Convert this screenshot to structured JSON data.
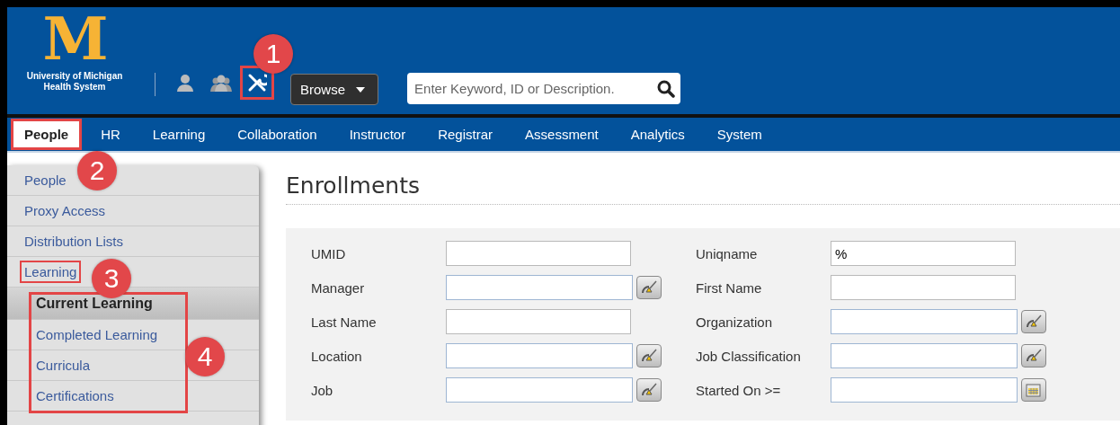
{
  "header": {
    "logo": {
      "letter": "M",
      "line1": "University of Michigan",
      "line2": "Health System"
    },
    "tools": [
      {
        "kind": "person",
        "annotated": false
      },
      {
        "kind": "group",
        "annotated": false
      },
      {
        "kind": "tools",
        "annotated": true
      }
    ],
    "browse": {
      "label": "Browse"
    },
    "search": {
      "placeholder": "Enter Keyword, ID or Description."
    }
  },
  "nav": [
    {
      "label": "People",
      "selected": true,
      "annotated": true
    },
    {
      "label": "HR",
      "selected": false,
      "annotated": false
    },
    {
      "label": "Learning",
      "selected": false,
      "annotated": false
    },
    {
      "label": "Collaboration",
      "selected": false,
      "annotated": false
    },
    {
      "label": "Instructor",
      "selected": false,
      "annotated": false
    },
    {
      "label": "Registrar",
      "selected": false,
      "annotated": false
    },
    {
      "label": "Assessment",
      "selected": false,
      "annotated": false
    },
    {
      "label": "Analytics",
      "selected": false,
      "annotated": false
    },
    {
      "label": "System",
      "selected": false,
      "annotated": false
    }
  ],
  "sidebar": {
    "items": [
      {
        "label": "People",
        "selected": false,
        "annotated": false
      },
      {
        "label": "Proxy Access",
        "selected": false,
        "annotated": false
      },
      {
        "label": "Distribution Lists",
        "selected": false,
        "annotated": false
      },
      {
        "label": "Learning",
        "selected": false,
        "annotated": true,
        "expanded": true,
        "children_annotated": true,
        "children": [
          {
            "label": "Current Learning",
            "selected": true
          },
          {
            "label": "Completed Learning",
            "selected": false
          },
          {
            "label": "Curricula",
            "selected": false
          },
          {
            "label": "Certifications",
            "selected": false
          }
        ]
      }
    ]
  },
  "page": {
    "title": "Enrollments",
    "form": {
      "columns": [
        [
          {
            "label": "UMID",
            "kind": "text"
          },
          {
            "label": "Manager",
            "kind": "lookup"
          },
          {
            "label": "Last Name",
            "kind": "text"
          },
          {
            "label": "Location",
            "kind": "lookup"
          },
          {
            "label": "Job",
            "kind": "lookup"
          }
        ],
        [
          {
            "label": "Uniqname",
            "kind": "text",
            "value": "%"
          },
          {
            "label": "First Name",
            "kind": "text"
          },
          {
            "label": "Organization",
            "kind": "lookup"
          },
          {
            "label": "Job Classification",
            "kind": "lookup"
          },
          {
            "label": "Started On >=",
            "kind": "date"
          }
        ]
      ]
    }
  },
  "callouts": [
    "1",
    "2",
    "3",
    "4"
  ]
}
